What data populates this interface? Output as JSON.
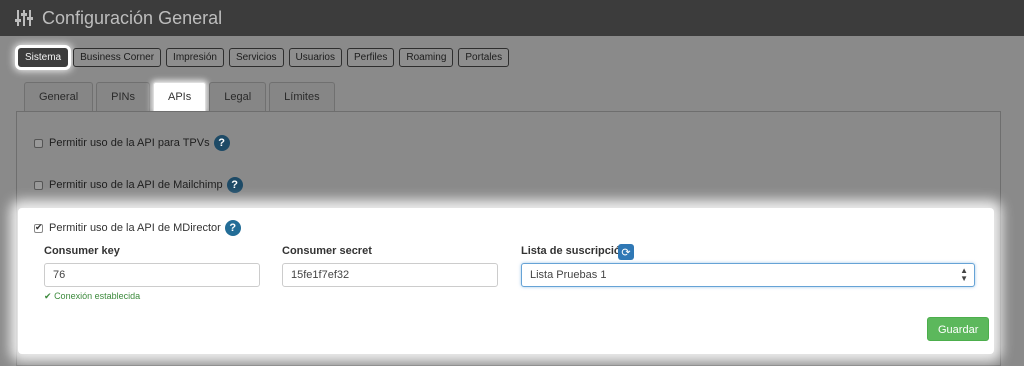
{
  "header": {
    "title": "Configuración General",
    "icon": "sliders-icon"
  },
  "topnav": {
    "items": [
      "Sistema",
      "Business Corner",
      "Impresión",
      "Servicios",
      "Usuarios",
      "Perfiles",
      "Roaming",
      "Portales"
    ],
    "active": "Sistema"
  },
  "tabs": {
    "items": [
      "General",
      "PINs",
      "APIs",
      "Legal",
      "Límites"
    ],
    "active": "APIs"
  },
  "api": {
    "tpv_label": "Permitir uso de la API para TPVs",
    "mailchimp_label": "Permitir uso de la API de Mailchimp",
    "mdirector_label": "Permitir uso de la API de MDirector",
    "help_glyph": "?",
    "tpv_checked": false,
    "mailchimp_checked": false,
    "mdirector_checked": true
  },
  "mdirector": {
    "consumer_key_label": "Consumer key",
    "consumer_key_value": "76",
    "consumer_secret_label": "Consumer secret",
    "consumer_secret_value": "15fe1f7ef32",
    "list_label": "Lista de suscripción",
    "list_value": "Lista Pruebas 1",
    "connection_status": "Conexión establecida",
    "save_label": "Guardar"
  },
  "colors": {
    "header_bg": "#3c3c3c",
    "help_icon": "#236d97",
    "success": "#5cb85c",
    "status_ok": "#3c8a3c"
  }
}
